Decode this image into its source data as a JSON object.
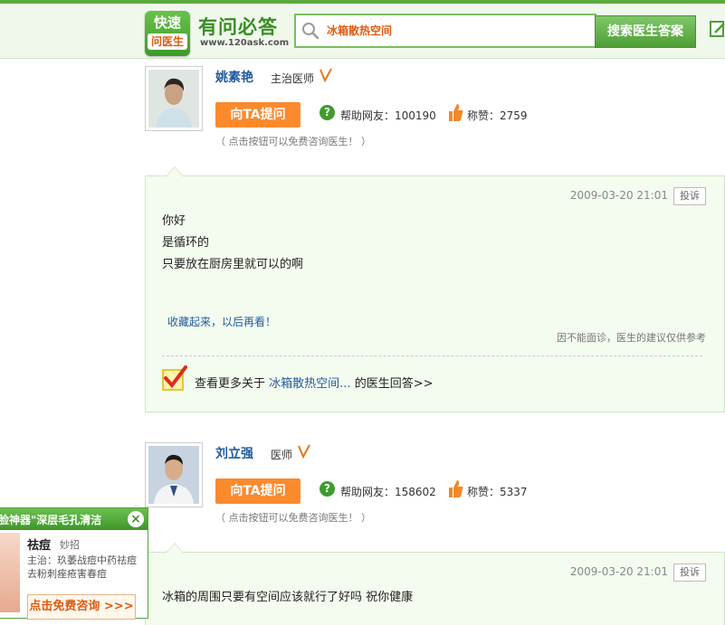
{
  "header": {
    "logo_line1": "快速",
    "logo_line2": "问医生",
    "site_name": "有问必答",
    "site_url": "www.120ask.com",
    "search_value": "冰箱散热空间",
    "search_button": "搜索医生答案"
  },
  "answers": [
    {
      "doctor_name": "姚素艳",
      "doctor_title": "主治医师",
      "ask_button": "向TA提问",
      "help_label": "帮助网友：100190",
      "like_label": "称赞：2759",
      "note": "（ 点击按钮可以免费咨询医生！ ）",
      "date": "2009-03-20 21:01",
      "report": "投诉",
      "text_lines": [
        "你好",
        "是循环的",
        "只要放在厨房里就可以的啊"
      ],
      "fav_link": "收藏起来，以后再看！",
      "disclaimer": "因不能面诊，医生的建议仅供参考",
      "more_prefix": "查看更多关于",
      "more_keyword": "冰箱散热空间...",
      "more_suffix": "的医生回答>>"
    },
    {
      "doctor_name": "刘立强",
      "doctor_title": "医师",
      "ask_button": "向TA提问",
      "help_label": "帮助网友：158602",
      "like_label": "称赞：5337",
      "note": "（ 点击按钮可以免费咨询医生！ ）",
      "date": "2009-03-20 21:01",
      "report": "投诉",
      "text_lines": [
        "冰箱的周围只要有空间应该就行了好吗 祝你健康"
      ]
    }
  ],
  "ad": {
    "title": "脸神器\"深层毛孔清洁",
    "close": "×",
    "name": "祛痘",
    "tag": "妙招",
    "desc": "主治：玖萎战痘中药祛痘去粉刺痤疮害春痘",
    "button": "点击免费咨询 >>>"
  },
  "colors": {
    "brand_green": "#5aaa3c",
    "accent_orange": "#fb8a2d",
    "link_blue": "#1f5a9f",
    "answer_bg": "#f4fbef"
  },
  "icons": [
    "search-icon",
    "edit-icon",
    "verified-v-icon",
    "help-icon",
    "thumbs-up-icon",
    "checkmark-icon",
    "close-icon"
  ]
}
